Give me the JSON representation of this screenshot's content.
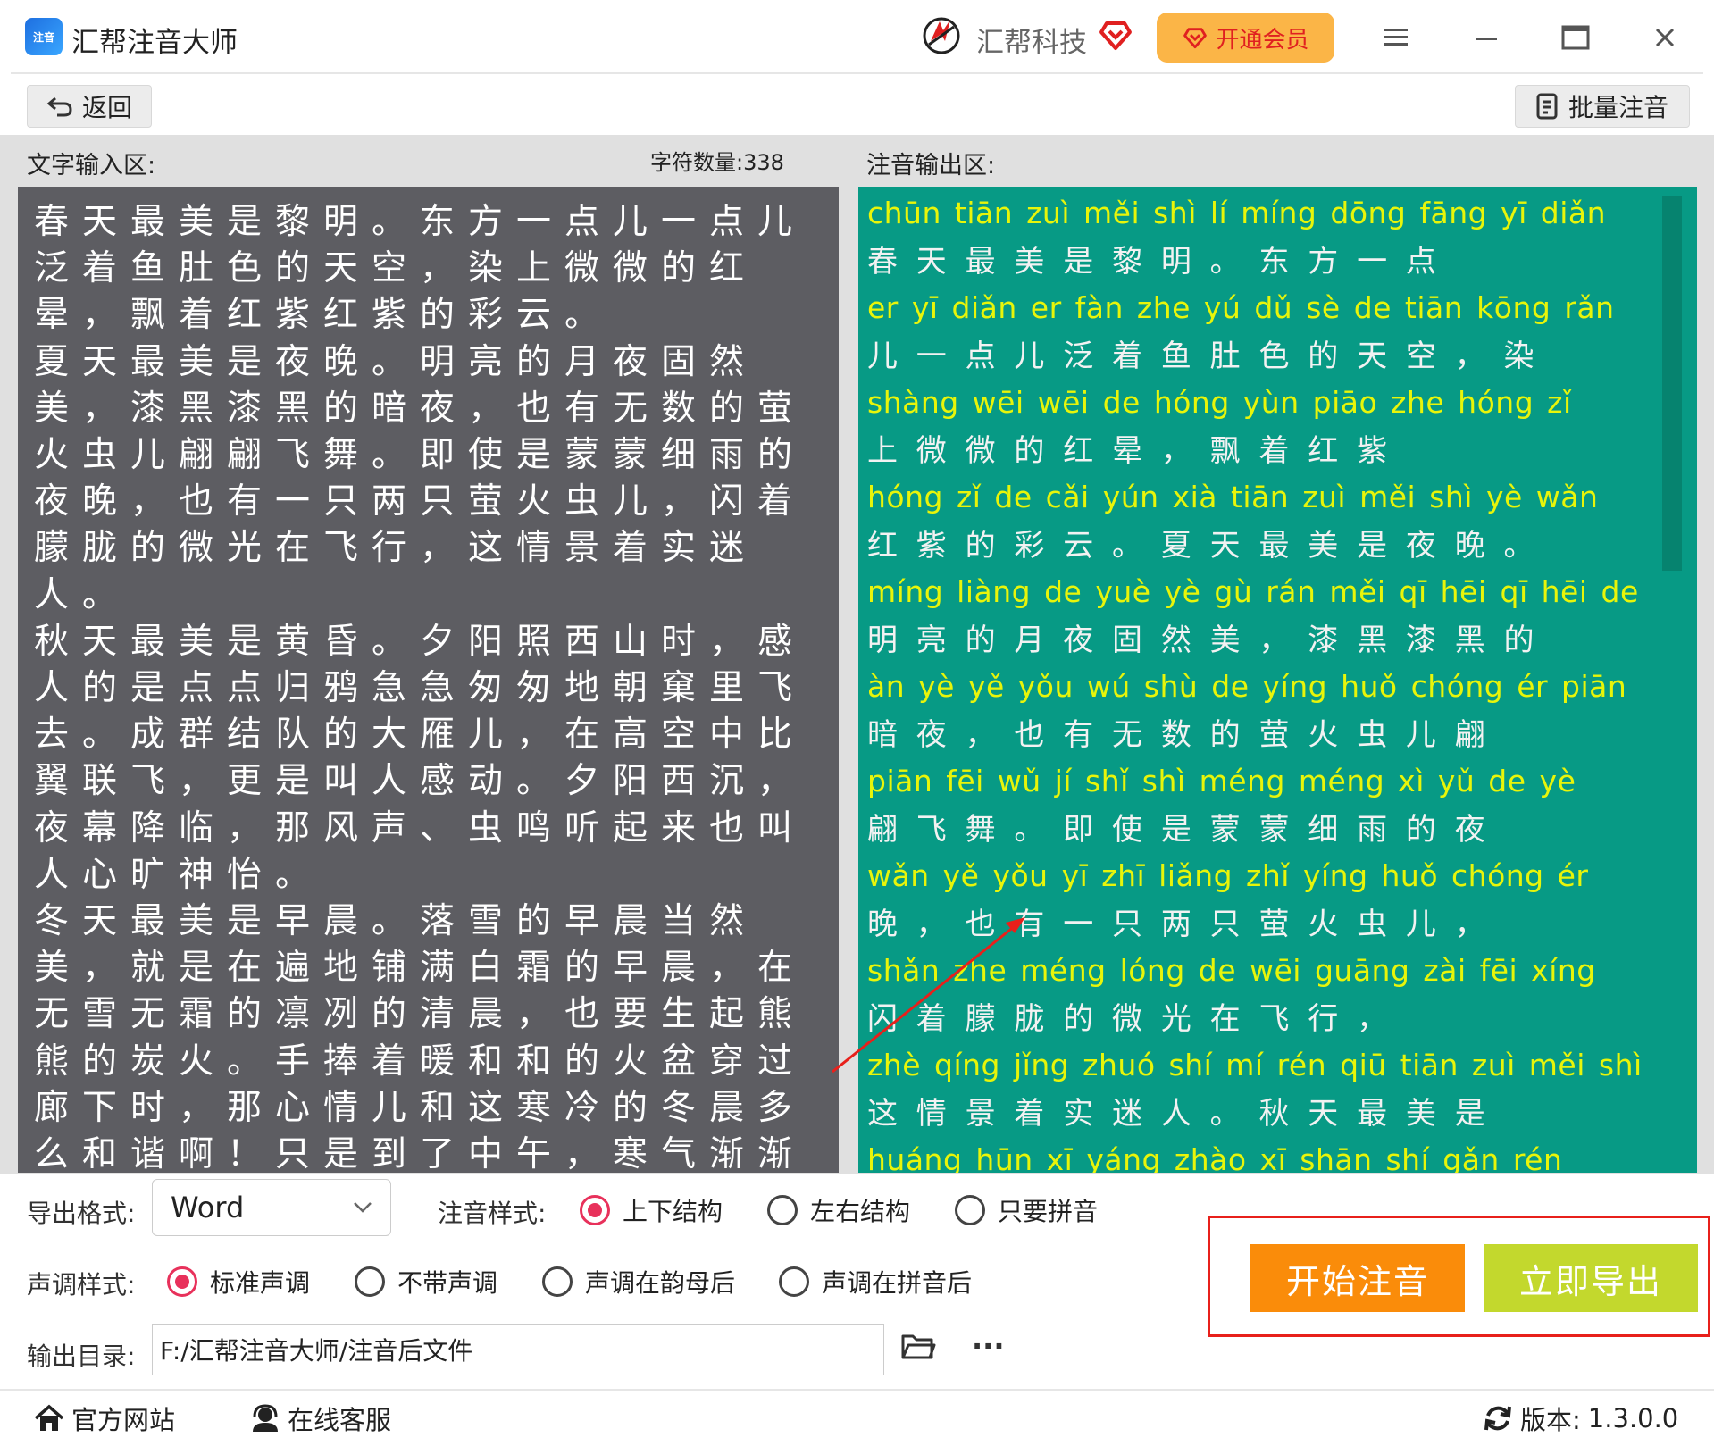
{
  "app": {
    "title": "汇帮注音大师",
    "logo_text": "注音",
    "brand": "汇帮科技",
    "vip_label": "开通会员"
  },
  "toolbar": {
    "back_label": "返回",
    "batch_label": "批量注音"
  },
  "input": {
    "label": "文字输入区:",
    "char_count_label": "字符数量:",
    "char_count": "338",
    "text": "春天最美是黎明。东方一点儿一点儿泛着鱼肚色的天空，染上微微的红晕，飘着红紫红紫的彩云。\n夏天最美是夜晚。明亮的月夜固然美，漆黑漆黑的暗夜，也有无数的萤火虫儿翩翩飞舞。即使是蒙蒙细雨的夜晚，也有一只两只萤火虫儿，闪着朦胧的微光在飞行，这情景着实迷人。\n秋天最美是黄昏。夕阳照西山时，感人的是点点归鸦急急匆匆地朝窠里飞去。成群结队的大雁儿，在高空中比翼联飞，更是叫人感动。夕阳西沉，夜幕降临，那风声、虫鸣听起来也叫人心旷神怡。\n冬天最美是早晨。落雪的早晨当然美，就是在遍地铺满白霜的早晨，在无雪无霜的凛冽的清晨，也要生起熊熊的炭火。手捧着暖和和的火盆穿过廊下时，那心情儿和这寒冷的冬晨多么和谐啊！只是到了中午，寒气渐渐"
  },
  "output": {
    "label": "注音输出区:",
    "rows": [
      {
        "pinyin": "chūn  tiān  zuì  měi  shì   lí   míng          dōng  fāng  yī  diǎn",
        "hanzi": " 春    天   最   美   是  黎   明   。   东    方   一   点"
      },
      {
        "pinyin": "er  yī  diǎn  er  fàn  zhe  yú  dǔ  sè  de  tiān  kōng          rǎn",
        "hanzi": "儿 一   点   儿  泛   着  鱼  肚  色  的  天    空    ，   染"
      },
      {
        "pinyin": "shàng  wēi  wēi  de  hóng  yùn          piāo  zhe  hóng  zǐ",
        "hanzi": "  上     微   微  的   红    晕    ，  飘    着   红    紫"
      },
      {
        "pinyin": "hóng  zǐ  de  cǎi  yún          xià  tiān  zuì  měi  shì  yè  wǎn",
        "hanzi": " 红   紫  的  彩   云   。  夏  天   最   美   是  夜  晚   。"
      },
      {
        "pinyin": "míng  liàng  de  yuè  yè  gù  rán  měi          qī  hēi  qī  hēi  de",
        "hanzi": " 明    亮   的  月  夜  固  然   美   ，  漆  黑  漆  黑  的"
      },
      {
        "pinyin": "àn  yè          yě  yǒu  wú  shù  de  yíng  huǒ  chóng  ér  piān",
        "hanzi": "暗  夜  ，  也  有   无  数  的   萤    火     虫    儿  翩"
      },
      {
        "pinyin": "piān  fēi  wǔ          jí  shǐ  shì  méng  méng  xì  yǔ  de  yè",
        "hanzi": " 翩   飞  舞  。 即  使  是   蒙      蒙    细  雨  的  夜"
      },
      {
        "pinyin": "wǎn          yě  yǒu  yī  zhī  liǎng  zhǐ  yíng  huǒ  chóng  ér",
        "hanzi": " 晚   ，  也  有  一  只   两    只   萤    火     虫     儿  ，"
      },
      {
        "pinyin": "shǎn  zhe  méng  lóng  de  wēi  guāng  zài  fēi  xíng",
        "hanzi": " 闪   着    朦     胧   的  微    光    在  飞  行   ，"
      },
      {
        "pinyin": "zhè  qíng  jǐng  zhuó  shí  mí  rén          qiū  tiān  zuì  měi  shì",
        "hanzi": " 这    情    景    着    实  迷  人  。  秋   天   最   美   是"
      },
      {
        "pinyin": "huáng  hūn          xī  yáng  zhào  xī  shān  shí          gǎn  rén",
        "hanzi": ""
      }
    ]
  },
  "options": {
    "format_label": "导出格式:",
    "format_value": "Word",
    "style_label": "注音样式:",
    "styles": [
      "上下结构",
      "左右结构",
      "只要拼音"
    ],
    "tone_label": "声调样式:",
    "tones": [
      "标准声调",
      "不带声调",
      "声调在韵母后",
      "声调在拼音后"
    ],
    "dir_label": "输出目录:",
    "dir_value": "F:/汇帮注音大师/注音后文件",
    "more_label": "···",
    "start_label": "开始注音",
    "export_label": "立即导出"
  },
  "footer": {
    "website": "官方网站",
    "service": "在线客服",
    "version_label": "版本:",
    "version": "1.3.0.0"
  },
  "colors": {
    "input_bg": "#5d5d62",
    "output_bg": "#079a85",
    "pinyin": "#e8f50a",
    "accent_radio": "#e8315b",
    "start_btn": "#fa8c0a",
    "export_btn": "#c3d82d",
    "vip_btn": "#fbb547",
    "highlight": "#e8201b"
  }
}
